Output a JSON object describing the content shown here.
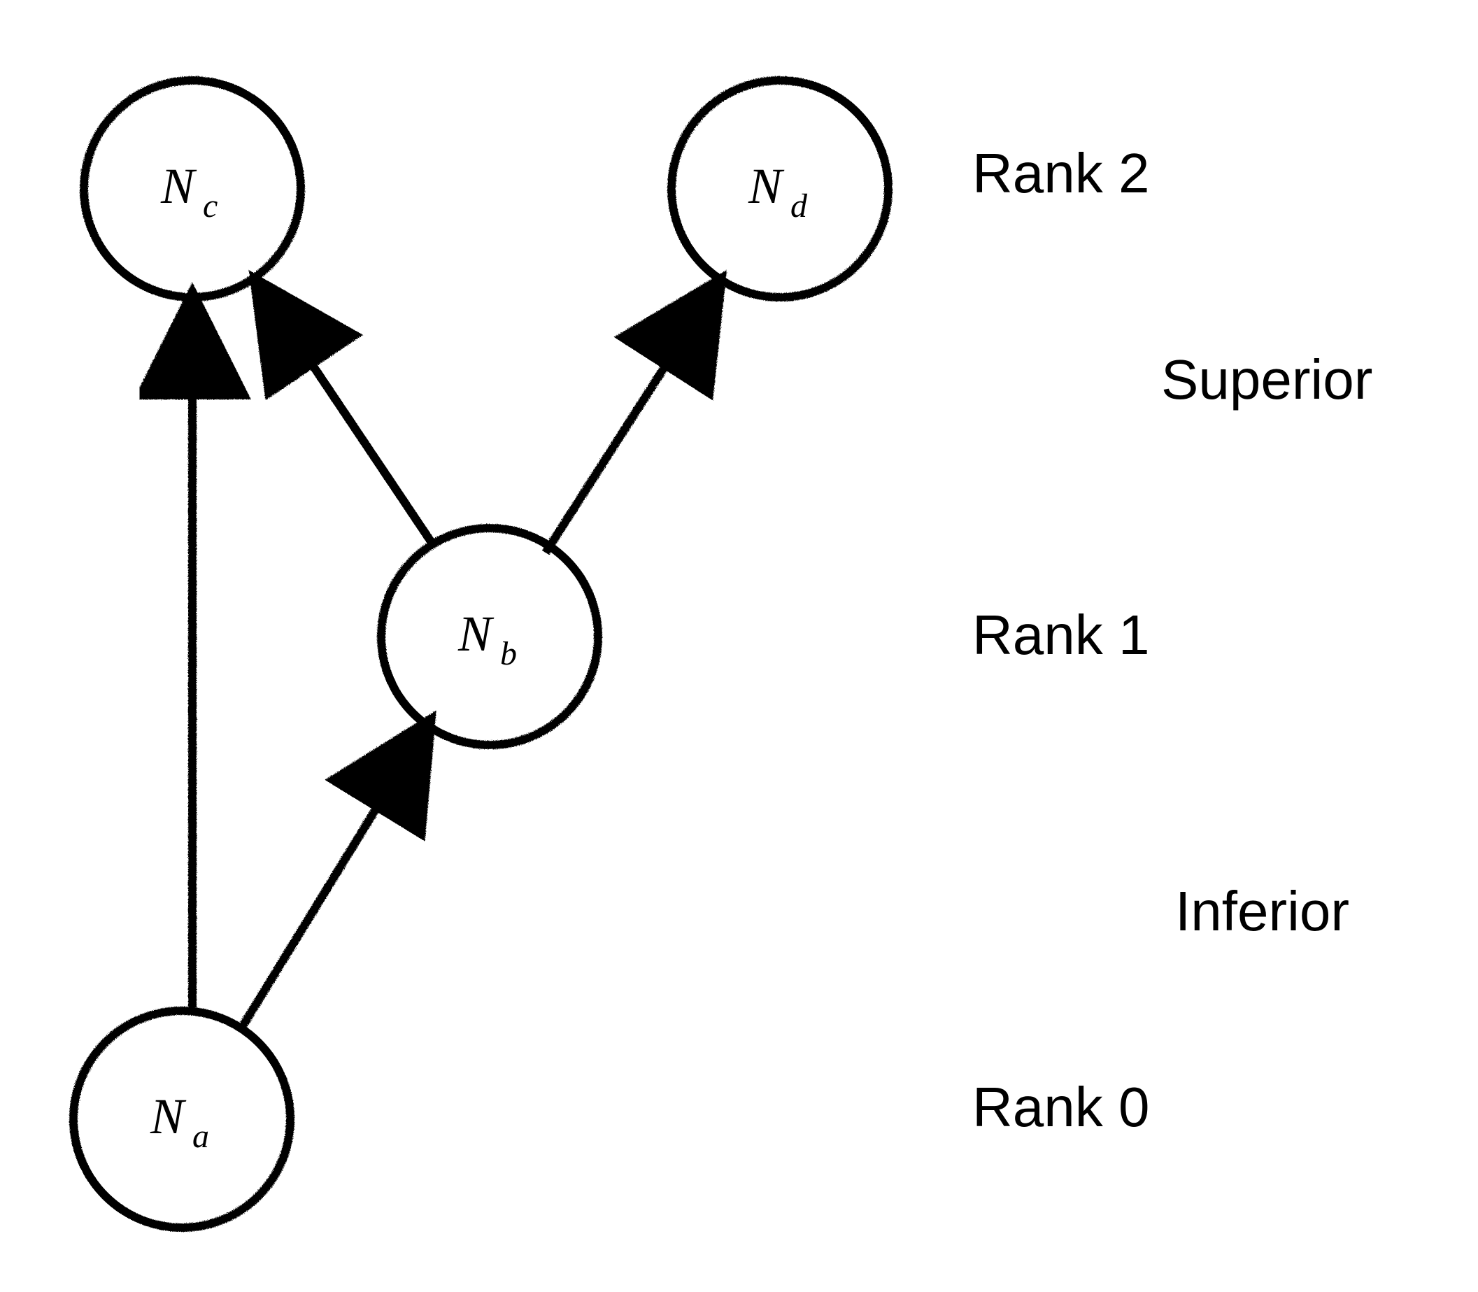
{
  "diagram": {
    "nodes": {
      "a": {
        "main": "N",
        "sub": "a"
      },
      "b": {
        "main": "N",
        "sub": "b"
      },
      "c": {
        "main": "N",
        "sub": "c"
      },
      "d": {
        "main": "N",
        "sub": "d"
      }
    },
    "ranks": {
      "r2": "Rank 2",
      "r1": "Rank 1",
      "r0": "Rank 0"
    },
    "legend": {
      "top": "Superior",
      "bottom": "Inferior"
    }
  },
  "chart_data": {
    "type": "diagram",
    "title": "",
    "nodes": [
      {
        "id": "Na",
        "rank": 0
      },
      {
        "id": "Nb",
        "rank": 1
      },
      {
        "id": "Nc",
        "rank": 2
      },
      {
        "id": "Nd",
        "rank": 2
      }
    ],
    "edges": [
      {
        "from": "Na",
        "to": "Nc"
      },
      {
        "from": "Na",
        "to": "Nb"
      },
      {
        "from": "Nb",
        "to": "Nc"
      },
      {
        "from": "Nb",
        "to": "Nd"
      }
    ],
    "axis": {
      "label_top": "Superior",
      "label_bottom": "Inferior",
      "ranks": [
        "Rank 0",
        "Rank 1",
        "Rank 2"
      ]
    }
  }
}
